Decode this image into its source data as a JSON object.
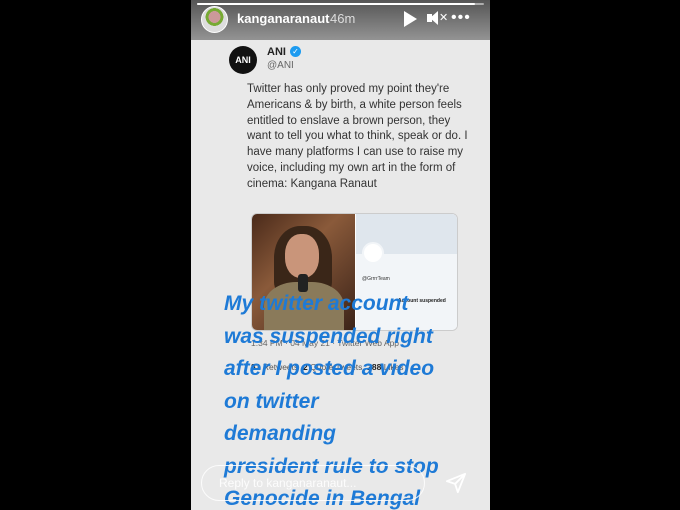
{
  "story": {
    "progress_fraction": 0.97,
    "username": "kanganaranaut",
    "time_ago": "46m",
    "icons": {
      "avatar": "profile-avatar",
      "play": "play-icon",
      "mute": "speaker-muted-icon",
      "more": "more-options-icon",
      "send": "send-icon"
    }
  },
  "tweet": {
    "author_logo": "ANI",
    "author_name": "ANI",
    "author_handle": "@ANI",
    "text": "Twitter has only proved my point they're Americans & by birth, a white person feels entitled to enslave a brown person, they want to tell you what to think, speak or do. I have many platforms I can use to raise my voice, including my own art in the form of cinema: Kangana Ranaut",
    "embedded_handle": "@GrrrrTeam",
    "embedded_status": "Account suspended",
    "meta": "1:34 PM · 04 May 21 · Twitter Web App",
    "retweets_count": "81",
    "retweets_label": "Retweets",
    "quotes_count": "2",
    "quotes_label": "Quote Tweets",
    "likes_count": "288",
    "likes_label": "Likes"
  },
  "caption_lines": [
    "My twitter account",
    "was suspended right",
    "after I posted a video",
    "on twitter",
    "demanding",
    "president rule to stop",
    "Genocide in Bengal"
  ],
  "reply": {
    "placeholder": "Reply to kanganaranaut..."
  },
  "colors": {
    "caption": "#1e7ad6",
    "background": "#000000",
    "story_bg": "#e9e9e9"
  }
}
